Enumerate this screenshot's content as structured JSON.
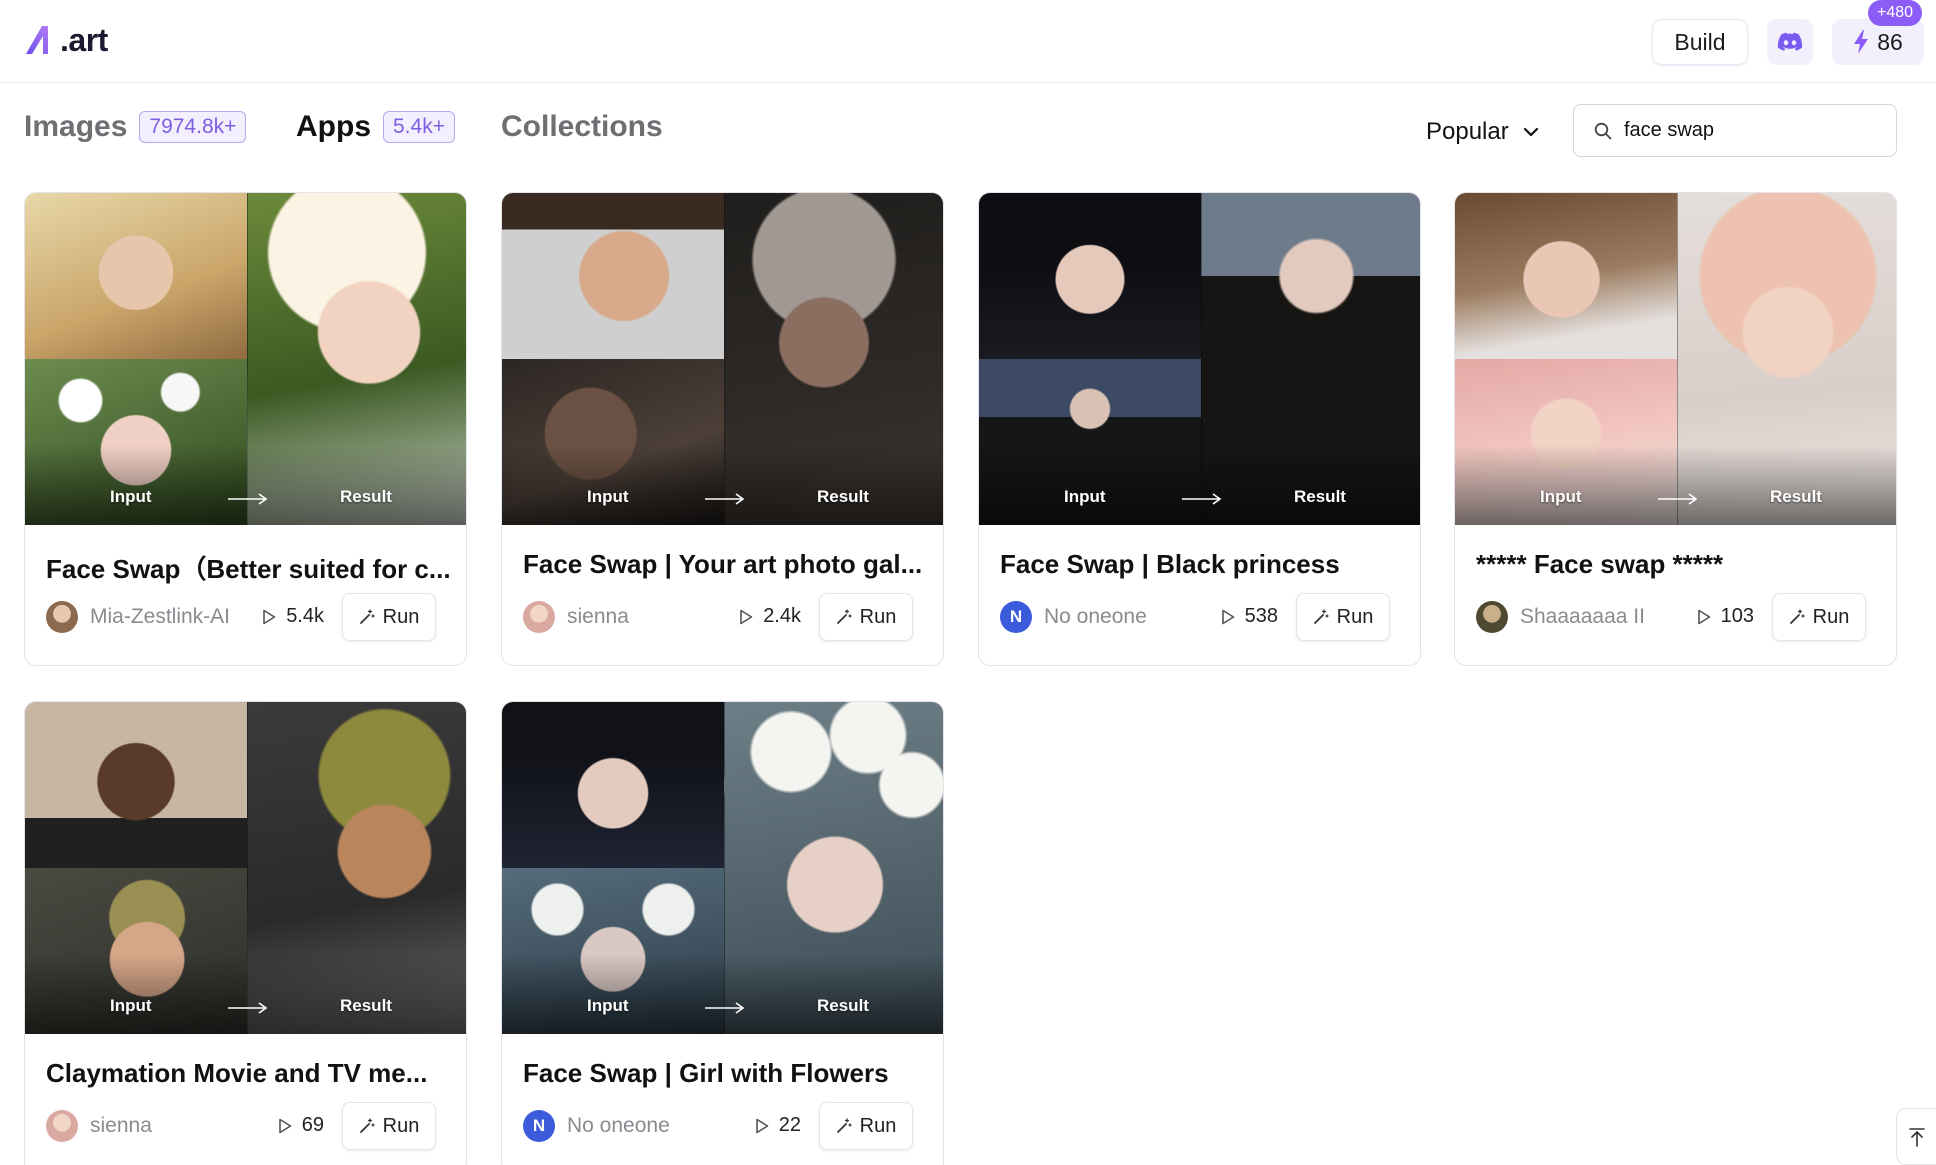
{
  "header": {
    "logo_text": ".art",
    "build_label": "Build",
    "credits_value": "86",
    "credits_bonus": "+480",
    "brand_color": "#8b5cf6"
  },
  "tabs": [
    {
      "label": "Images",
      "count": "7974.8k+",
      "active": false
    },
    {
      "label": "Apps",
      "count": "5.4k+",
      "active": true
    },
    {
      "label": "Collections",
      "active": false
    }
  ],
  "sort": {
    "selected": "Popular"
  },
  "search": {
    "value": "face swap"
  },
  "thumb_labels": {
    "input": "Input",
    "result": "Result"
  },
  "run_label": "Run",
  "cards": [
    {
      "title": "Face Swap（Better suited for c...",
      "author": "Mia-Zestlink-AI",
      "runs": "5.4k",
      "avatar": "photo"
    },
    {
      "title": "Face Swap | Your art photo gal...",
      "author": "sienna",
      "runs": "2.4k",
      "avatar": "photo"
    },
    {
      "title": "Face Swap | Black princess",
      "author": "No oneone",
      "runs": "538",
      "avatar_letter": "N"
    },
    {
      "title": "***** Face swap *****",
      "author": "Shaaaaaaa II",
      "runs": "103",
      "avatar": "photo"
    },
    {
      "title": "Claymation Movie and TV me...",
      "author": "sienna",
      "runs": "69",
      "avatar": "photo"
    },
    {
      "title": "Face Swap | Girl with Flowers",
      "author": "No oneone",
      "runs": "22",
      "avatar_letter": "N"
    }
  ]
}
